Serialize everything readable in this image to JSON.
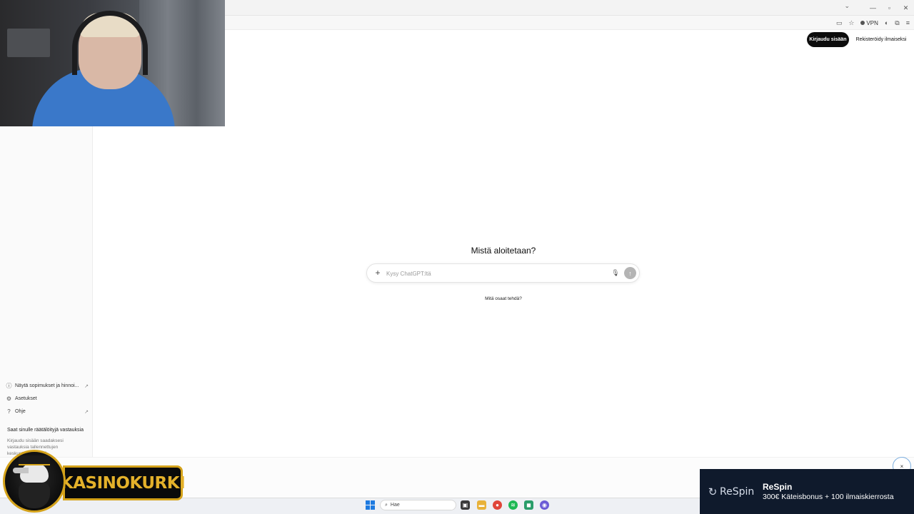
{
  "browser": {
    "tab_dropdown": "⌄",
    "window_controls": [
      "—",
      "▫",
      "✕"
    ],
    "vpn_label": "VPN"
  },
  "header": {
    "login_label": "Kirjaudu sisään",
    "signup_label": "Rekisteröidy ilmaiseksi"
  },
  "sidebar": {
    "items": [
      {
        "label": "Näytä sopimukset ja hinnoi...",
        "icon": "info-icon",
        "external": true
      },
      {
        "label": "Asetukset",
        "icon": "gear-icon",
        "external": false
      },
      {
        "label": "Ohje",
        "icon": "help-icon",
        "external": true
      }
    ],
    "promo_title": "Saat sinulle räätälöityjä vastauksia",
    "promo_body": "Kirjaudu sisään saadaksesi vastauksia tallennettujen keskustelujesi sekä"
  },
  "main": {
    "heading": "Mistä aloitetaan?",
    "composer_placeholder": "Kysy ChatGPT:ltä",
    "suggestion": "Mitä osaat tehdä?"
  },
  "overlay": {
    "brand_logo_text": "KASINOKURKI",
    "close_symbol": "×"
  },
  "ad": {
    "logo_text": "ReSpin",
    "name": "ReSpin",
    "offer": "300€ Käteisbonus + 100 ilmaiskierrosta"
  },
  "taskbar": {
    "search_label": "Hae"
  },
  "colors": {
    "login_bg": "#0d0d0d",
    "send_bg": "#b4b4b4",
    "gold": "#d4a21a",
    "ad_bg": "#0f1a2c",
    "start_blue": "#1e7ae0"
  }
}
